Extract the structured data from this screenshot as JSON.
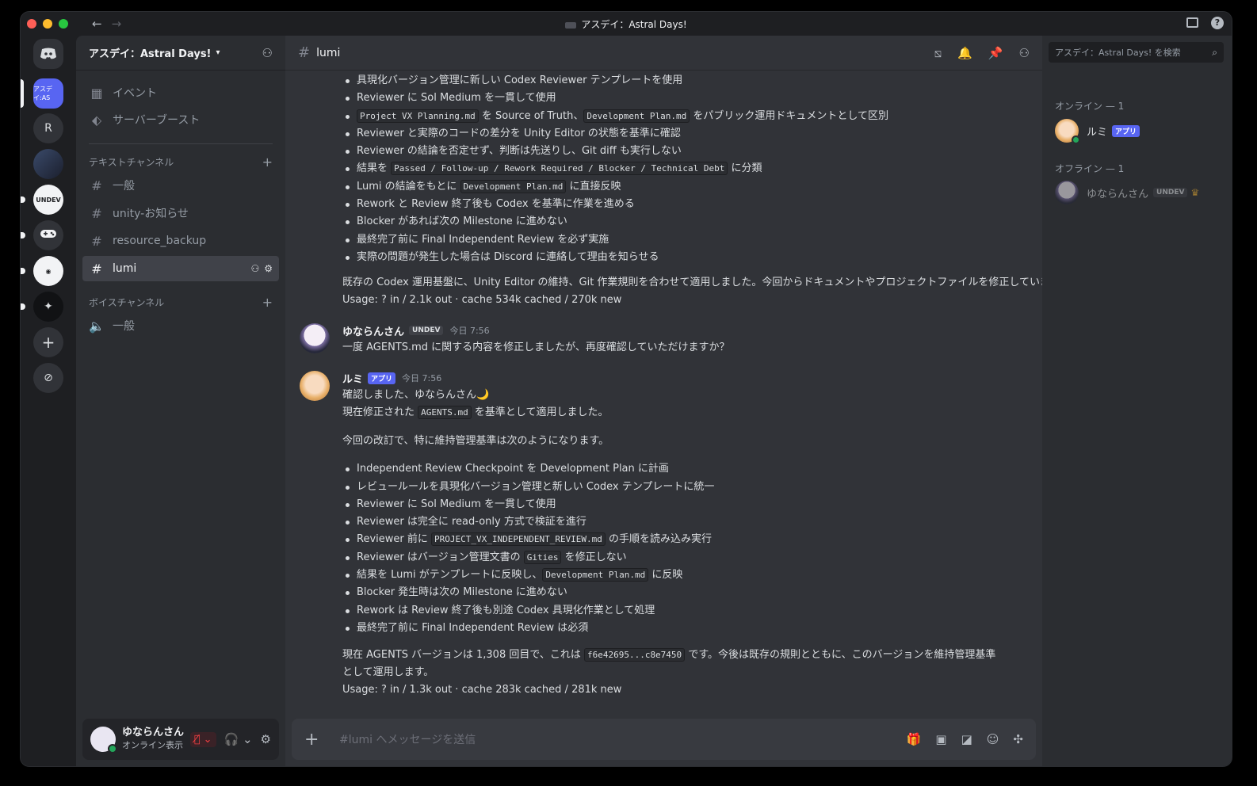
{
  "window": {
    "title": "アスデイ：Astral Days!"
  },
  "rail": {
    "servers": [
      {
        "label": "アスデイ:AS",
        "kind": "active"
      },
      {
        "label": "R",
        "kind": "letter"
      },
      {
        "label": "",
        "kind": "avatar"
      },
      {
        "label": "UNDEV",
        "kind": "white"
      },
      {
        "label": "🎮",
        "kind": "icon"
      },
      {
        "label": "◉",
        "kind": "white"
      },
      {
        "label": "✦",
        "kind": "dark"
      },
      {
        "label": "+",
        "kind": "action"
      },
      {
        "label": "⊘",
        "kind": "action"
      }
    ]
  },
  "sidebar": {
    "guild_name": "アスデイ：Astral Days!",
    "top_items": [
      {
        "icon": "calendar-icon",
        "label": "イベント"
      },
      {
        "icon": "boost-icon",
        "label": "サーバーブースト"
      }
    ],
    "text_category": "テキストチャンネル",
    "text_channels": [
      {
        "label": "一般"
      },
      {
        "label": "unity-お知らせ"
      },
      {
        "label": "resource_backup"
      },
      {
        "label": "lumi",
        "selected": true
      }
    ],
    "voice_category": "ボイスチャンネル",
    "voice_channels": [
      {
        "label": "一般"
      }
    ]
  },
  "user": {
    "name": "ゆならんさん",
    "status": "オンライン表示"
  },
  "channel": {
    "name": "lumi"
  },
  "messages": {
    "top_bullets": [
      {
        "text": "具現化バージョン管理に新しい Codex Reviewer テンプレートを使用"
      },
      {
        "text": "Reviewer に Sol Medium を一貫して使用"
      },
      {
        "pre": "",
        "code": "Project VX Planning.md",
        "mid": " を Source of Truth、",
        "code2": "Development Plan.md",
        "post": " をパブリック運用ドキュメントとして区別"
      },
      {
        "text": "Reviewer と実際のコードの差分を Unity Editor の状態を基準に確認"
      },
      {
        "text": "Reviewer の結論を否定せず、判断は先送りし、Git diff も実行しない"
      },
      {
        "pre": "結果を ",
        "code": "Passed / Follow-up / Rework Required / Blocker / Technical Debt",
        "post": " に分類"
      },
      {
        "pre": "Lumi の結論をもとに ",
        "code": "Development Plan.md",
        "post": " に直接反映"
      },
      {
        "text": "Rework と Review 終了後も Codex を基準に作業を進める"
      },
      {
        "text": "Blocker があれば次の Milestone に進めない"
      },
      {
        "text": "最終完了前に Final Independent Review を必ず実施"
      },
      {
        "text": "実際の問題が発生した場合は Discord に連絡して理由を知らせる"
      }
    ],
    "top_para": "既存の Codex 運用基盤に、Unity Editor の維持、Git 作業規則を合わせて適用しました。今回からドキュメントやプロジェクトファイルを修正していません。",
    "top_usage": "Usage: ? in / 2.1k out · cache 534k cached / 270k new",
    "msg1": {
      "author": "ゆならんさん",
      "tag": "UNDEV",
      "time": "今日 7:56",
      "text": "一度 AGENTS.md に関する内容を修正しましたが、再度確認していただけますか？"
    },
    "msg2": {
      "author": "ルミ",
      "tag": "アプリ",
      "time": "今日 7:56",
      "line1": "確認しました、ゆならんさん🌙",
      "line2_pre": "現在修正された ",
      "line2_code": "AGENTS.md",
      "line2_post": " を基準として適用しました。",
      "intro": "今回の改訂で、特に維持管理基準は次のようになります。",
      "bullets": [
        {
          "text": "Independent Review Checkpoint を Development Plan に計画"
        },
        {
          "text": "レビュールールを具現化バージョン管理と新しい Codex テンプレートに統一"
        },
        {
          "text": "Reviewer に Sol Medium を一貫して使用"
        },
        {
          "text": "Reviewer は完全に read-only 方式で検証を進行"
        },
        {
          "pre": "Reviewer 前に ",
          "code": "PROJECT_VX_INDEPENDENT_REVIEW.md",
          "post": " の手順を読み込み実行"
        },
        {
          "pre": "Reviewer はバージョン管理文書の ",
          "code": "Gities",
          "post": " を修正しない"
        },
        {
          "pre": "結果を Lumi がテンプレートに反映し、",
          "code": "Development Plan.md",
          "post": " に反映"
        },
        {
          "text": "Blocker 発生時は次の Milestone に進めない"
        },
        {
          "text": "Rework は Review 終了後も別途 Codex 具現化作業として処理"
        },
        {
          "text": "最終完了前に Final Independent Review は必須"
        }
      ],
      "outro_pre": "現在 AGENTS バージョンは 1,308 回目で、これは ",
      "outro_code": "f6e42695...c8e7450",
      "outro_post": " です。今後は既存の規則とともに、このバージョンを維持管理基準として運用します。",
      "usage": "Usage: ? in / 1.3k out · cache 283k cached / 281k new"
    }
  },
  "composer": {
    "placeholder": "#lumi へメッセージを送信"
  },
  "members": {
    "search_placeholder": "アスデイ：Astral Days! を検索",
    "online_label": "オンライン — 1",
    "offline_label": "オフライン — 1",
    "online": [
      {
        "name": "ルミ",
        "tag": "アプリ"
      }
    ],
    "offline": [
      {
        "name": "ゆならんさん",
        "tag": "UNDEV"
      }
    ]
  },
  "colors": {
    "accent": "#5865f2",
    "online": "#23a55a",
    "danger": "#f23f42"
  }
}
